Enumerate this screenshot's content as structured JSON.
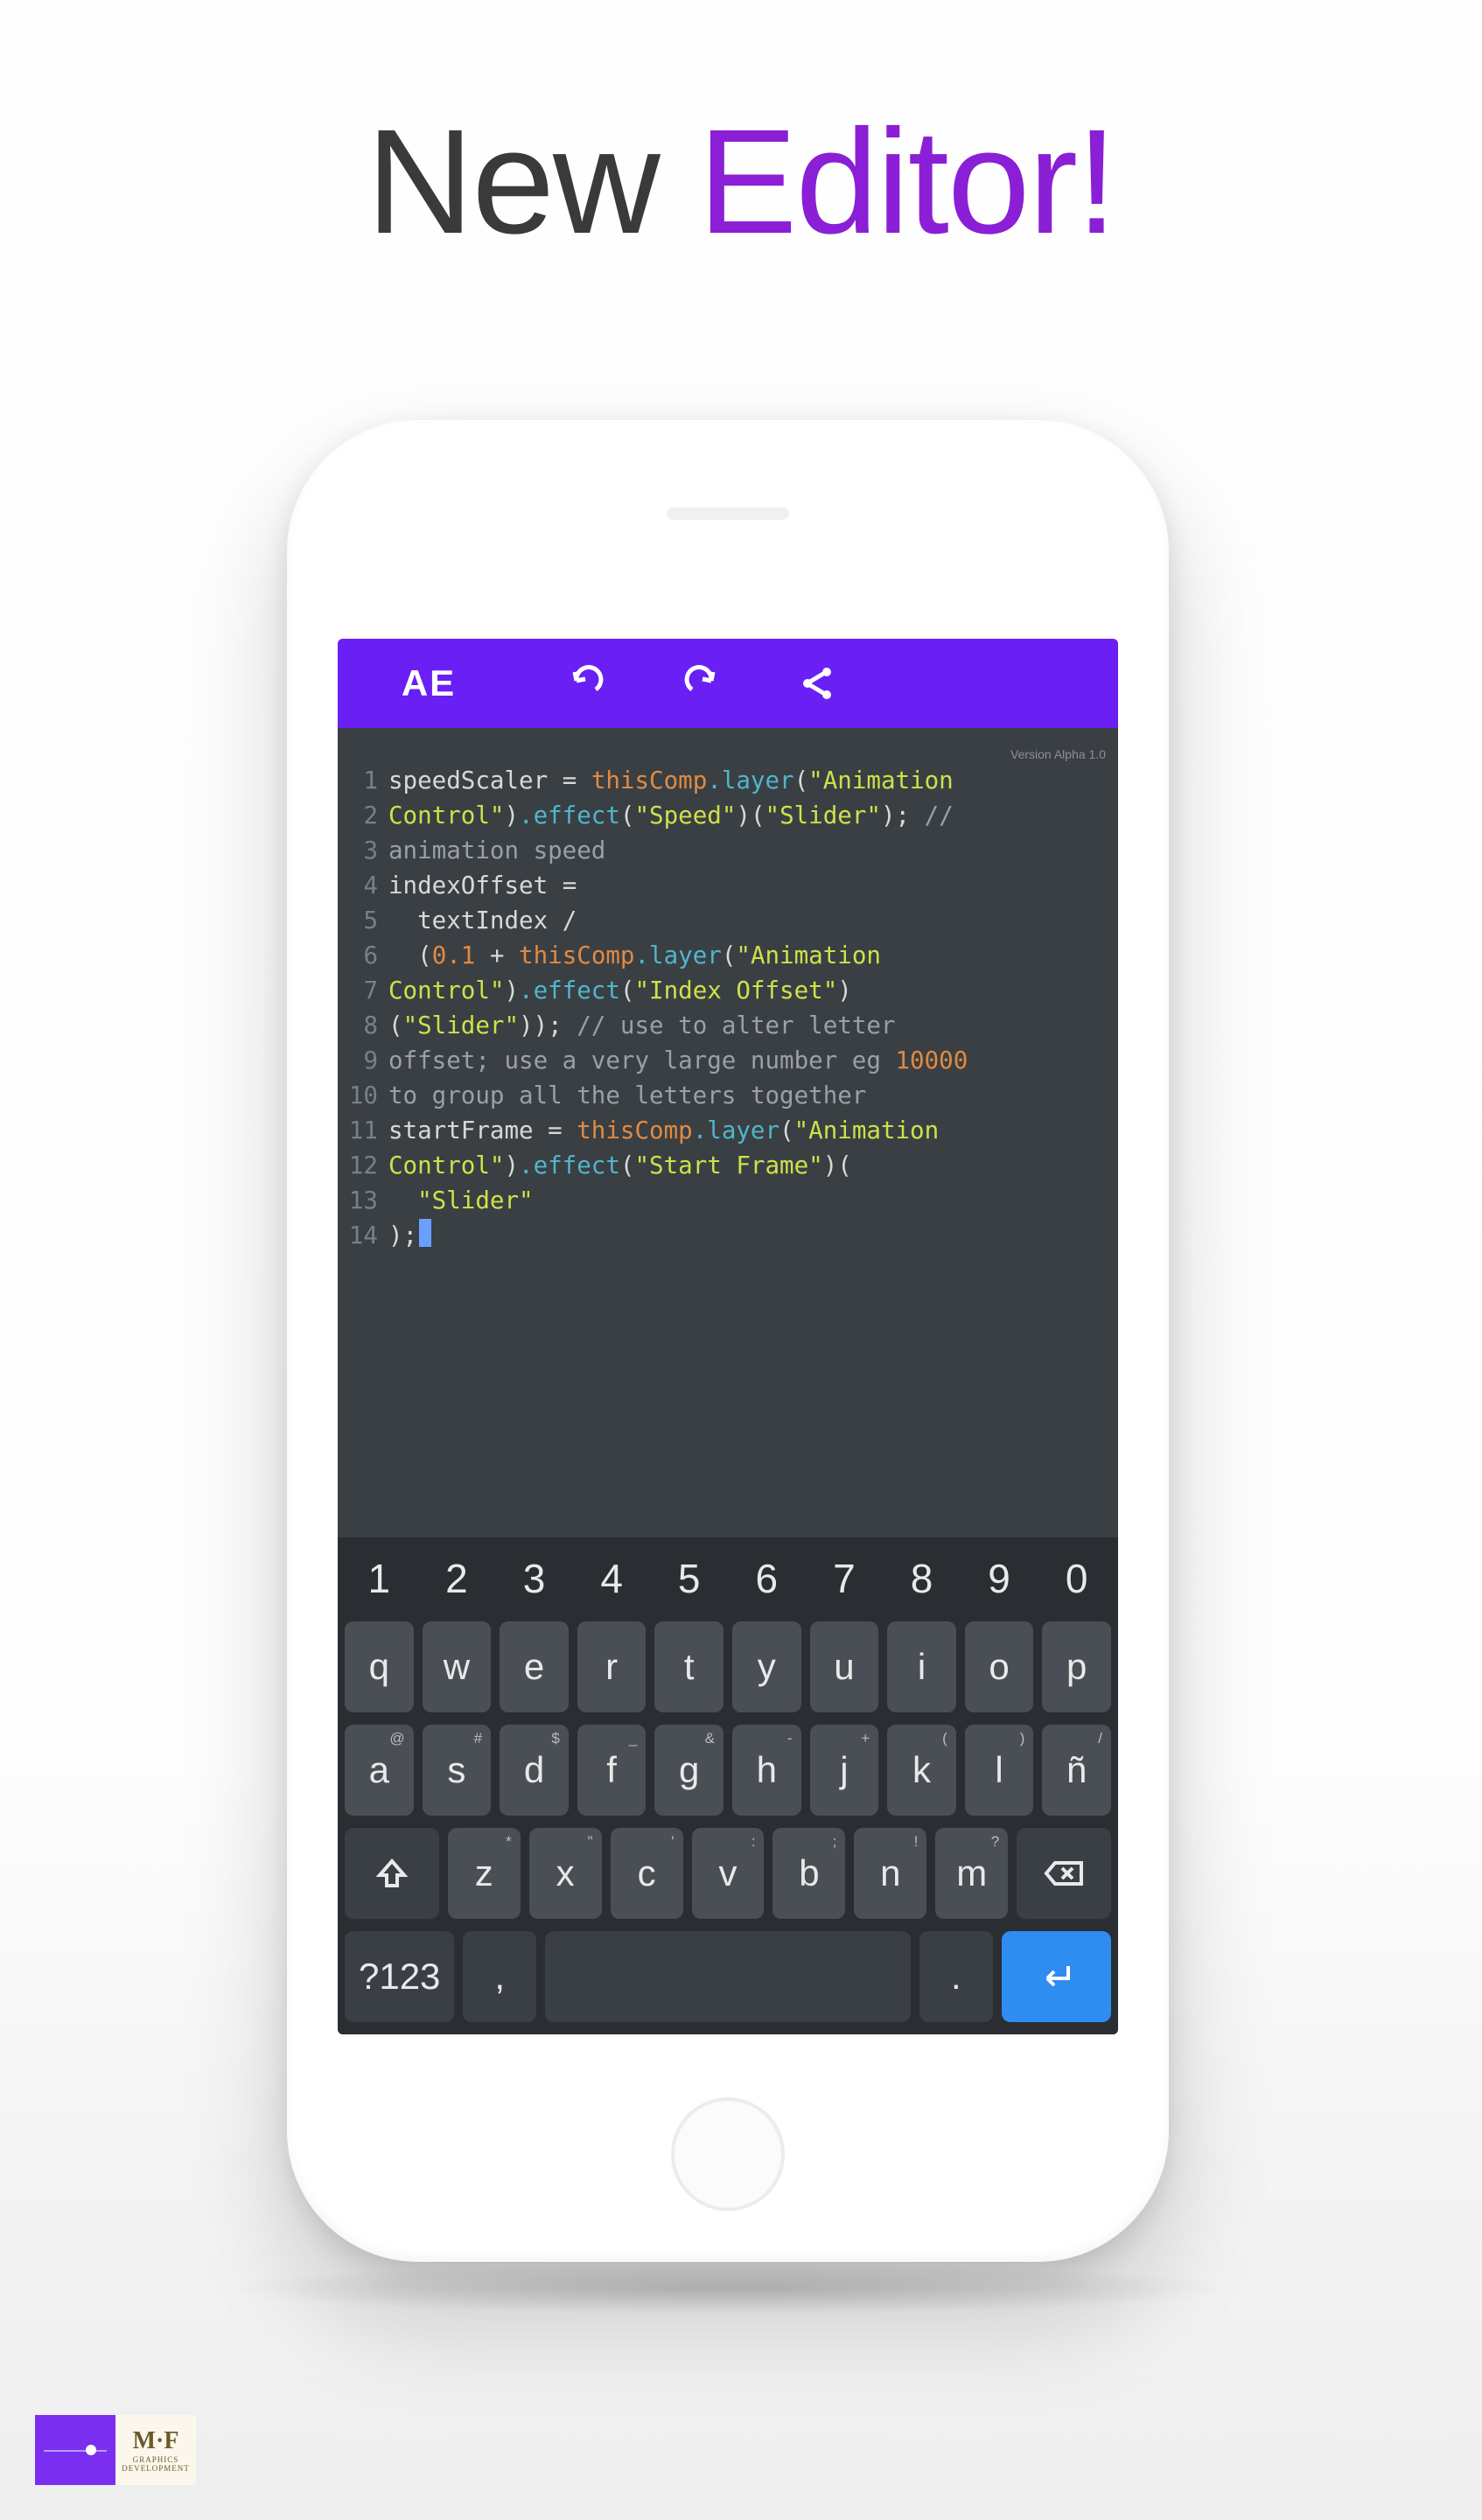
{
  "title": {
    "part1": "New ",
    "part2": "Editor!"
  },
  "toolbar": {
    "logo": "AE",
    "undo_label": "Undo",
    "redo_label": "Redo",
    "share_label": "Share"
  },
  "editor": {
    "version_label": "Version Alpha 1.0",
    "line_numbers": [
      "1",
      "2",
      "3",
      "4",
      "5",
      "6",
      "7",
      "8",
      "9",
      "10",
      "11",
      "12",
      "13",
      "14"
    ],
    "lines": [
      [
        {
          "cls": "t-id",
          "t": "speedScaler "
        },
        {
          "cls": "t-pn",
          "t": "= "
        },
        {
          "cls": "t-kw",
          "t": "thisComp"
        },
        {
          "cls": "t-fn",
          "t": ".layer"
        },
        {
          "cls": "t-pn",
          "t": "("
        },
        {
          "cls": "t-str",
          "t": "\"Animation"
        }
      ],
      [
        {
          "cls": "t-str",
          "t": "Control\""
        },
        {
          "cls": "t-pn",
          "t": ")"
        },
        {
          "cls": "t-fn",
          "t": ".effect"
        },
        {
          "cls": "t-pn",
          "t": "("
        },
        {
          "cls": "t-str",
          "t": "\"Speed\""
        },
        {
          "cls": "t-pn",
          "t": ")("
        },
        {
          "cls": "t-str",
          "t": "\"Slider\""
        },
        {
          "cls": "t-pn",
          "t": "); "
        },
        {
          "cls": "t-cm",
          "t": "//"
        }
      ],
      [
        {
          "cls": "t-cm",
          "t": "animation speed"
        }
      ],
      [
        {
          "cls": "t-id",
          "t": "indexOffset "
        },
        {
          "cls": "t-pn",
          "t": "="
        }
      ],
      [
        {
          "cls": "t-id",
          "t": "  textIndex "
        },
        {
          "cls": "t-pn",
          "t": "/"
        }
      ],
      [
        {
          "cls": "t-pn",
          "t": "  ("
        },
        {
          "cls": "t-num",
          "t": "0.1"
        },
        {
          "cls": "t-pn",
          "t": " + "
        },
        {
          "cls": "t-kw",
          "t": "thisComp"
        },
        {
          "cls": "t-fn",
          "t": ".layer"
        },
        {
          "cls": "t-pn",
          "t": "("
        },
        {
          "cls": "t-str",
          "t": "\"Animation"
        }
      ],
      [
        {
          "cls": "t-str",
          "t": "Control\""
        },
        {
          "cls": "t-pn",
          "t": ")"
        },
        {
          "cls": "t-fn",
          "t": ".effect"
        },
        {
          "cls": "t-pn",
          "t": "("
        },
        {
          "cls": "t-str",
          "t": "\"Index Offset\""
        },
        {
          "cls": "t-pn",
          "t": ")"
        }
      ],
      [
        {
          "cls": "t-pn",
          "t": "("
        },
        {
          "cls": "t-str",
          "t": "\"Slider\""
        },
        {
          "cls": "t-pn",
          "t": ")); "
        },
        {
          "cls": "t-cm",
          "t": "// use to alter letter"
        }
      ],
      [
        {
          "cls": "t-cm",
          "t": "offset; use a very large number eg "
        },
        {
          "cls": "t-num",
          "t": "10000"
        }
      ],
      [
        {
          "cls": "t-cm",
          "t": "to group all the letters together"
        }
      ],
      [
        {
          "cls": "t-id",
          "t": "startFrame "
        },
        {
          "cls": "t-pn",
          "t": "= "
        },
        {
          "cls": "t-kw",
          "t": "thisComp"
        },
        {
          "cls": "t-fn",
          "t": ".layer"
        },
        {
          "cls": "t-pn",
          "t": "("
        },
        {
          "cls": "t-str",
          "t": "\"Animation"
        }
      ],
      [
        {
          "cls": "t-str",
          "t": "Control\""
        },
        {
          "cls": "t-pn",
          "t": ")"
        },
        {
          "cls": "t-fn",
          "t": ".effect"
        },
        {
          "cls": "t-pn",
          "t": "("
        },
        {
          "cls": "t-str",
          "t": "\"Start Frame\""
        },
        {
          "cls": "t-pn",
          "t": ")("
        }
      ],
      [
        {
          "cls": "t-str",
          "t": "  \"Slider\""
        }
      ],
      [
        {
          "cls": "t-pn",
          "t": ");"
        }
      ]
    ]
  },
  "keyboard": {
    "rows": [
      {
        "type": "num",
        "keys": [
          {
            "label": "1"
          },
          {
            "label": "2"
          },
          {
            "label": "3"
          },
          {
            "label": "4"
          },
          {
            "label": "5"
          },
          {
            "label": "6"
          },
          {
            "label": "7"
          },
          {
            "label": "8"
          },
          {
            "label": "9"
          },
          {
            "label": "0"
          }
        ]
      },
      {
        "type": "letters",
        "keys": [
          {
            "label": "q"
          },
          {
            "label": "w"
          },
          {
            "label": "e"
          },
          {
            "label": "r"
          },
          {
            "label": "t"
          },
          {
            "label": "y"
          },
          {
            "label": "u"
          },
          {
            "label": "i"
          },
          {
            "label": "o"
          },
          {
            "label": "p"
          }
        ]
      },
      {
        "type": "letters-sup",
        "keys": [
          {
            "label": "a",
            "sup": "@"
          },
          {
            "label": "s",
            "sup": "#"
          },
          {
            "label": "d",
            "sup": "$"
          },
          {
            "label": "f",
            "sup": "_"
          },
          {
            "label": "g",
            "sup": "&"
          },
          {
            "label": "h",
            "sup": "-"
          },
          {
            "label": "j",
            "sup": "+"
          },
          {
            "label": "k",
            "sup": "("
          },
          {
            "label": "l",
            "sup": ")"
          },
          {
            "label": "ñ",
            "sup": "/"
          }
        ]
      },
      {
        "type": "zxc",
        "keys": [
          {
            "label": "z",
            "sup": "*"
          },
          {
            "label": "x",
            "sup": "\""
          },
          {
            "label": "c",
            "sup": "'"
          },
          {
            "label": "v",
            "sup": ":"
          },
          {
            "label": "b",
            "sup": ";"
          },
          {
            "label": "n",
            "sup": "!"
          },
          {
            "label": "m",
            "sup": "?"
          }
        ]
      },
      {
        "type": "bottom",
        "keys": [
          {
            "label": "?123",
            "name": "symbols-key"
          },
          {
            "label": ",",
            "name": "comma-key"
          },
          {
            "label": "",
            "name": "space-key"
          },
          {
            "label": ".",
            "name": "period-key"
          },
          {
            "label": "↵",
            "name": "enter-key"
          }
        ]
      }
    ],
    "shift_label": "⇧",
    "backspace_label": "⌫"
  },
  "badges": {
    "mf_top": "M·F",
    "mf_mid": "GRAPHICS",
    "mf_bot": "DEVELOPMENT"
  }
}
